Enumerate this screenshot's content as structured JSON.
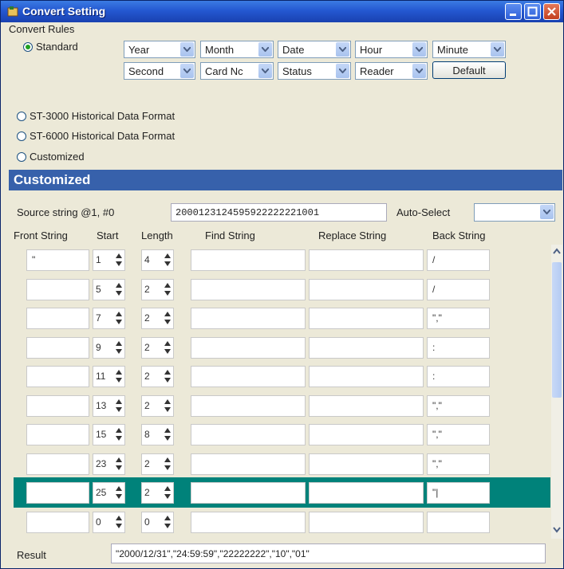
{
  "window": {
    "title": "Convert Setting"
  },
  "rules": {
    "legend": "Convert Rules",
    "options": [
      "Standard",
      "ST-3000 Historical Data Format",
      "ST-6000 Historical Data Format",
      "Customized"
    ],
    "selected": "Standard",
    "fields_row1": [
      "Year",
      "Month",
      "Date",
      "Hour",
      "Minute"
    ],
    "fields_row2": [
      "Second",
      "Card Nc",
      "Status",
      "Reader"
    ],
    "default_button": "Default"
  },
  "customized": {
    "header": "Customized",
    "source_label": "Source string  @1, #0",
    "source_value": "2000123124595922222221001",
    "auto_select_label": "Auto-Select",
    "auto_select_value": "",
    "columns": [
      "Front String",
      "Start",
      "Length",
      "Find String",
      "Replace String",
      "Back String"
    ],
    "rows": [
      {
        "front": "\"",
        "start": "1",
        "length": "4",
        "find": "",
        "replace": "",
        "back": "/"
      },
      {
        "front": "",
        "start": "5",
        "length": "2",
        "find": "",
        "replace": "",
        "back": "/"
      },
      {
        "front": "",
        "start": "7",
        "length": "2",
        "find": "",
        "replace": "",
        "back": "\",\""
      },
      {
        "front": "",
        "start": "9",
        "length": "2",
        "find": "",
        "replace": "",
        "back": ":"
      },
      {
        "front": "",
        "start": "11",
        "length": "2",
        "find": "",
        "replace": "",
        "back": ":"
      },
      {
        "front": "",
        "start": "13",
        "length": "2",
        "find": "",
        "replace": "",
        "back": "\",\""
      },
      {
        "front": "",
        "start": "15",
        "length": "8",
        "find": "",
        "replace": "",
        "back": "\",\""
      },
      {
        "front": "",
        "start": "23",
        "length": "2",
        "find": "",
        "replace": "",
        "back": "\",\""
      },
      {
        "front": "",
        "start": "25",
        "length": "2",
        "find": "",
        "replace": "",
        "back": "\"|"
      },
      {
        "front": "",
        "start": "0",
        "length": "0",
        "find": "",
        "replace": "",
        "back": ""
      }
    ],
    "selected_row": 8
  },
  "result": {
    "label": "Result",
    "value": "\"2000/12/31\",\"24:59:59\",\"22222222\",\"10\",\"01\""
  }
}
